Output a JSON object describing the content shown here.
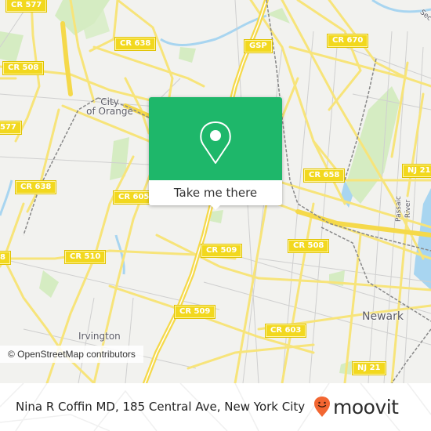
{
  "map": {
    "road_shields": [
      {
        "label": "CR 577"
      },
      {
        "label": "CR 638"
      },
      {
        "label": "CR 508"
      },
      {
        "label": "577"
      },
      {
        "label": "GSP"
      },
      {
        "label": "CR 670"
      },
      {
        "label": "CR 658"
      },
      {
        "label": "NJ 21"
      },
      {
        "label": "CR 638"
      },
      {
        "label": "CR 605"
      },
      {
        "label": "CR 510"
      },
      {
        "label": "CR 509"
      },
      {
        "label": "CR 508"
      },
      {
        "label": "8"
      },
      {
        "label": "CR 509"
      },
      {
        "label": "CR 603"
      },
      {
        "label": "NJ 21"
      }
    ],
    "places": {
      "city_of_orange": "City\nof Orange",
      "irvington": "Irvington",
      "newark": "Newark",
      "passaic_river": "Passaic River",
      "second_river": "Sec"
    },
    "attribution": "© OpenStreetMap contributors",
    "colors": {
      "background": "#f2f2ef",
      "road_major": "#f7e47a",
      "shield": "#f2d81e",
      "water": "#a8d5f0",
      "park": "#d5ecc2"
    }
  },
  "popup": {
    "pin_icon": "map-pin-icon",
    "button_label": "Take me there",
    "color": "#1eb76a"
  },
  "footer": {
    "location_text": "Nina R Coffin MD, 185 Central Ave, New York City",
    "brand_name": "moovit",
    "brand_color": "#f26631"
  }
}
